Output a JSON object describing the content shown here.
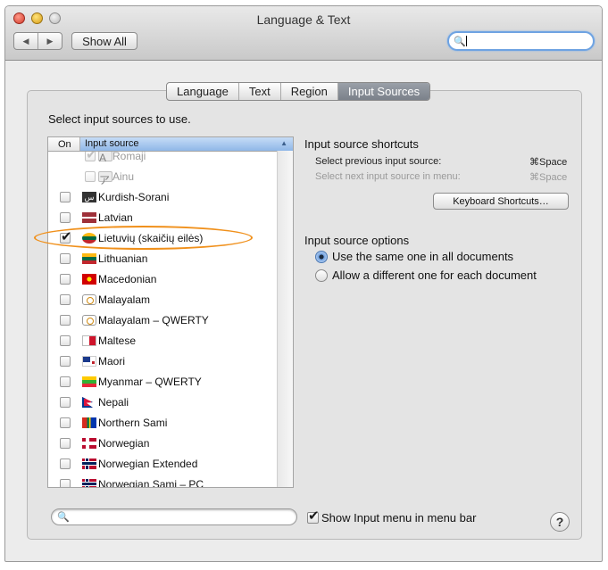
{
  "window": {
    "title": "Language & Text"
  },
  "toolbar": {
    "back_icon": "◀",
    "forward_icon": "▶",
    "show_all_label": "Show All",
    "search_icon": "🔍",
    "search_value": ""
  },
  "tabs": [
    {
      "label": "Language",
      "active": false
    },
    {
      "label": "Text",
      "active": false
    },
    {
      "label": "Region",
      "active": false
    },
    {
      "label": "Input Sources",
      "active": true
    }
  ],
  "input_sources": {
    "heading": "Select input sources to use.",
    "col_on": "On",
    "col_source": "Input source",
    "sort_icon": "▲",
    "items": [
      {
        "name": "Romaji",
        "checked": true,
        "dimmed": true,
        "icon": "romaji-icon",
        "glyph": "A"
      },
      {
        "name": "Ainu",
        "checked": false,
        "dimmed": true,
        "icon": "ainu-icon",
        "glyph": "ア"
      },
      {
        "name": "Kurdish-Sorani",
        "checked": false,
        "dimmed": false,
        "icon": "kurdish-sorani-flag-icon",
        "glyph": "س"
      },
      {
        "name": "Latvian",
        "checked": false,
        "dimmed": false,
        "icon": "latvian-flag-icon",
        "glyph": ""
      },
      {
        "name": "Lietuvių (skaičių eilės)",
        "checked": true,
        "dimmed": false,
        "icon": "lithuanian-flag-icon",
        "glyph": ""
      },
      {
        "name": "Lithuanian",
        "checked": false,
        "dimmed": false,
        "icon": "lithuanian-flag-icon",
        "glyph": ""
      },
      {
        "name": "Macedonian",
        "checked": false,
        "dimmed": false,
        "icon": "macedonian-flag-icon",
        "glyph": ""
      },
      {
        "name": "Malayalam",
        "checked": false,
        "dimmed": false,
        "icon": "malayalam-icon",
        "glyph": ""
      },
      {
        "name": "Malayalam – QWERTY",
        "checked": false,
        "dimmed": false,
        "icon": "malayalam-icon",
        "glyph": ""
      },
      {
        "name": "Maltese",
        "checked": false,
        "dimmed": false,
        "icon": "maltese-flag-icon",
        "glyph": ""
      },
      {
        "name": "Maori",
        "checked": false,
        "dimmed": false,
        "icon": "maori-flag-icon",
        "glyph": ""
      },
      {
        "name": "Myanmar – QWERTY",
        "checked": false,
        "dimmed": false,
        "icon": "myanmar-flag-icon",
        "glyph": ""
      },
      {
        "name": "Nepali",
        "checked": false,
        "dimmed": false,
        "icon": "nepali-flag-icon",
        "glyph": ""
      },
      {
        "name": "Northern Sami",
        "checked": false,
        "dimmed": false,
        "icon": "sami-flag-icon",
        "glyph": ""
      },
      {
        "name": "Norwegian",
        "checked": false,
        "dimmed": false,
        "icon": "norwegian-flag-icon",
        "glyph": ""
      },
      {
        "name": "Norwegian Extended",
        "checked": false,
        "dimmed": false,
        "icon": "norwegian-extended-flag-icon",
        "glyph": ""
      },
      {
        "name": "Norwegian Sami – PC",
        "checked": false,
        "dimmed": false,
        "icon": "norwegian-extended-flag-icon",
        "glyph": ""
      }
    ],
    "bottom_search_icon": "🔍",
    "bottom_search_value": ""
  },
  "shortcuts": {
    "heading": "Input source shortcuts",
    "prev_label": "Select previous input source:",
    "prev_key": "⌘Space",
    "next_label": "Select next input source in menu:",
    "next_key": "⌘Space",
    "button_label": "Keyboard Shortcuts…"
  },
  "options": {
    "heading": "Input source options",
    "same_label": "Use the same one in all documents",
    "different_label": "Allow a different one for each document",
    "selected": "same"
  },
  "show_menu": {
    "label": "Show Input menu in menu bar",
    "checked": true
  },
  "help": {
    "label": "?"
  },
  "colors": {
    "highlight": "#f0901b",
    "active_tab": "#7b818a",
    "selection": "#8fb7e8"
  }
}
